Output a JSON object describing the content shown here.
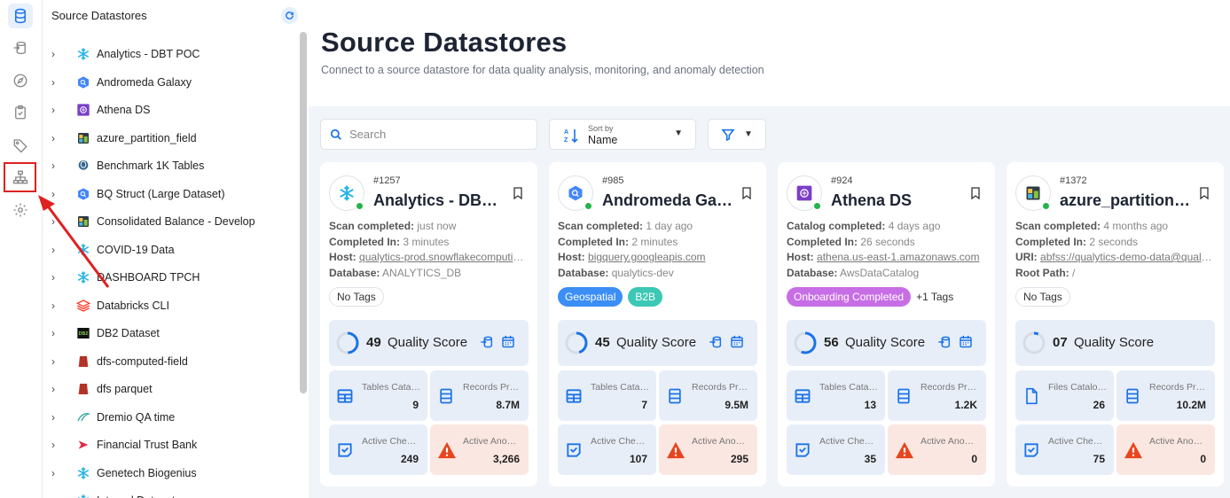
{
  "rail": {
    "items": [
      {
        "icon": "database-icon",
        "active": true
      },
      {
        "icon": "database-arrow-icon"
      },
      {
        "icon": "compass-icon"
      },
      {
        "icon": "clipboard-check-icon"
      },
      {
        "icon": "tag-icon"
      },
      {
        "icon": "sitemap-icon",
        "highlighted": true
      },
      {
        "icon": "gear-icon"
      }
    ]
  },
  "tree": {
    "title": "Source Datastores",
    "items": [
      {
        "label": "Analytics - DBT POC",
        "icon": "snowflake-icon"
      },
      {
        "label": "Andromeda Galaxy",
        "icon": "bigquery-icon"
      },
      {
        "label": "Athena DS",
        "icon": "athena-icon"
      },
      {
        "label": "azure_partition_field",
        "icon": "azure-datalake-icon"
      },
      {
        "label": "Benchmark 1K Tables",
        "icon": "postgres-icon"
      },
      {
        "label": "BQ Struct (Large Dataset)",
        "icon": "bigquery-icon"
      },
      {
        "label": "Consolidated Balance - Develop",
        "icon": "azure-datalake-icon"
      },
      {
        "label": "COVID-19 Data",
        "icon": "snowflake-icon"
      },
      {
        "label": "DASHBOARD TPCH",
        "icon": "snowflake-icon"
      },
      {
        "label": "Databricks CLI",
        "icon": "databricks-icon"
      },
      {
        "label": "DB2 Dataset",
        "icon": "db2-icon"
      },
      {
        "label": "dfs-computed-field",
        "icon": "s3-icon"
      },
      {
        "label": "dfs parquet",
        "icon": "s3-icon"
      },
      {
        "label": "Dremio QA time",
        "icon": "dremio-icon"
      },
      {
        "label": "Financial Trust Bank",
        "icon": "trino-icon"
      },
      {
        "label": "Genetech Biogenius",
        "icon": "snowflake-icon"
      },
      {
        "label": "Internal Dataset",
        "icon": "snowflake-icon"
      }
    ]
  },
  "header": {
    "title": "Source Datastores",
    "subtitle": "Connect to a source datastore for data quality analysis, monitoring, and anomaly detection"
  },
  "toolbar": {
    "search_placeholder": "Search",
    "sort_caption": "Sort by",
    "sort_value": "Name"
  },
  "cards": [
    {
      "id": "#1257",
      "name": "Analytics - DBT POC",
      "logo": "snowflake-icon",
      "line1_label": "Scan completed:",
      "line1_value": "just now",
      "line2_label": "Completed In:",
      "line2_value": "3 minutes",
      "line3_label": "Host:",
      "line3_value": "qualytics-prod.snowflakecomputing.com",
      "line4_label": "Database:",
      "line4_value": "ANALYTICS_DB",
      "tags": [
        {
          "label": "No Tags",
          "style": "none"
        }
      ],
      "more_tags": "",
      "score": "49",
      "score_label": "Quality Score",
      "score_fraction": 0.49,
      "score_icons": true,
      "stat1_label": "Tables Cataloged",
      "stat1_value": "9",
      "stat1_icon": "table-icon",
      "stat2_label": "Records Profiled",
      "stat2_value": "8.7M",
      "stat3_label": "Active Checks",
      "stat3_value": "249",
      "stat4_label": "Active Anomalies",
      "stat4_value": "3,266"
    },
    {
      "id": "#985",
      "name": "Andromeda Galaxy",
      "logo": "bigquery-icon",
      "line1_label": "Scan completed:",
      "line1_value": "1 day ago",
      "line2_label": "Completed In:",
      "line2_value": "2 minutes",
      "line3_label": "Host:",
      "line3_value": "bigquery.googleapis.com",
      "line4_label": "Database:",
      "line4_value": "qualytics-dev",
      "tags": [
        {
          "label": "Geospatial",
          "style": "blue"
        },
        {
          "label": "B2B",
          "style": "teal"
        }
      ],
      "more_tags": "",
      "score": "45",
      "score_label": "Quality Score",
      "score_fraction": 0.45,
      "score_icons": true,
      "stat1_label": "Tables Cataloged",
      "stat1_value": "7",
      "stat1_icon": "table-icon",
      "stat2_label": "Records Profiled",
      "stat2_value": "9.5M",
      "stat3_label": "Active Checks",
      "stat3_value": "107",
      "stat4_label": "Active Anomalies",
      "stat4_value": "295"
    },
    {
      "id": "#924",
      "name": "Athena DS",
      "logo": "athena-icon",
      "line1_label": "Catalog completed:",
      "line1_value": "4 days ago",
      "line2_label": "Completed In:",
      "line2_value": "26 seconds",
      "line3_label": "Host:",
      "line3_value": "athena.us-east-1.amazonaws.com",
      "line4_label": "Database:",
      "line4_value": "AwsDataCatalog",
      "tags": [
        {
          "label": "Onboarding Completed",
          "style": "purple"
        }
      ],
      "more_tags": "+1 Tags",
      "score": "56",
      "score_label": "Quality Score",
      "score_fraction": 0.56,
      "score_icons": true,
      "stat1_label": "Tables Cataloged",
      "stat1_value": "13",
      "stat1_icon": "table-icon",
      "stat2_label": "Records Profiled",
      "stat2_value": "1.2K",
      "stat3_label": "Active Checks",
      "stat3_value": "35",
      "stat4_label": "Active Anomalies",
      "stat4_value": "0"
    },
    {
      "id": "#1372",
      "name": "azure_partition_field",
      "logo": "azure-datalake-icon",
      "line1_label": "Scan completed:",
      "line1_value": "4 months ago",
      "line2_label": "Completed In:",
      "line2_value": "2 seconds",
      "line3_label": "URI:",
      "line3_value": "abfss://qualytics-demo-data@qualyticsdemo.dfs.core.windows.net",
      "line4_label": "Root Path:",
      "line4_value": "/",
      "tags": [
        {
          "label": "No Tags",
          "style": "none"
        }
      ],
      "more_tags": "",
      "score": "07",
      "score_label": "Quality Score",
      "score_fraction": 0.07,
      "score_icons": false,
      "stat1_label": "Files Cataloged",
      "stat1_value": "26",
      "stat1_icon": "file-icon",
      "stat2_label": "Records Profiled",
      "stat2_value": "10.2M",
      "stat3_label": "Active Checks",
      "stat3_value": "75",
      "stat4_label": "Active Anomalies",
      "stat4_value": "0"
    }
  ],
  "colors": {
    "accent": "#1a73e8",
    "online": "#25b34b",
    "warning": "#e8451e",
    "highlight": "#e02020"
  }
}
